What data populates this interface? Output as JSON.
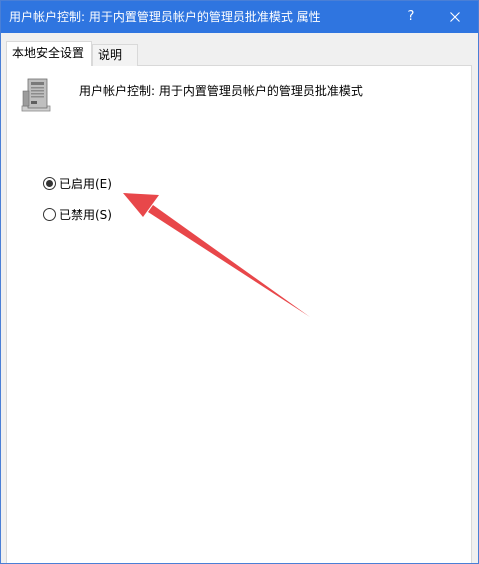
{
  "window": {
    "title": "用户帐户控制: 用于内置管理员帐户的管理员批准模式 属性",
    "help_label": "?"
  },
  "tabs": [
    {
      "label": "本地安全设置",
      "active": true
    },
    {
      "label": "说明",
      "active": false
    }
  ],
  "policy": {
    "icon": "server-icon",
    "name": "用户帐户控制: 用于内置管理员帐户的管理员批准模式"
  },
  "options": [
    {
      "label": "已启用(E)",
      "checked": true
    },
    {
      "label": "已禁用(S)",
      "checked": false
    }
  ],
  "annotation": {
    "color": "#e8474a",
    "icon": "arrow-annotation"
  },
  "colors": {
    "titlebar": "#2f75e0",
    "panel": "#ffffff",
    "frame": "#f0f0f0"
  }
}
